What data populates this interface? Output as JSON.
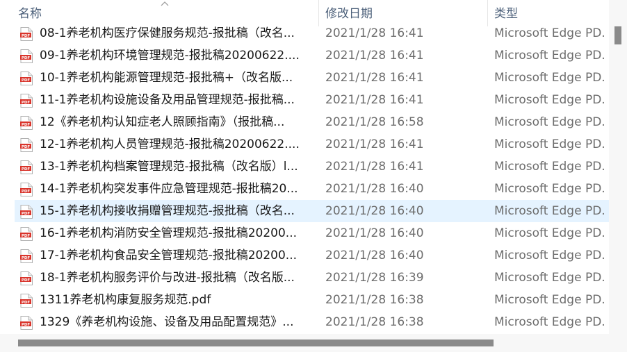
{
  "header": {
    "name_label": "名称",
    "date_label": "修改日期",
    "type_label": "类型"
  },
  "files": [
    {
      "name": "08-1养老机构医疗保健服务规范-报批稿（改名...",
      "date": "2021/1/28 16:41",
      "type": "Microsoft Edge PD."
    },
    {
      "name": "09-1养老机构环境管理规范-报批稿20200622....",
      "date": "2021/1/28 16:41",
      "type": "Microsoft Edge PD."
    },
    {
      "name": "10-1养老机构能源管理规范-报批稿+（改名版...",
      "date": "2021/1/28 16:41",
      "type": "Microsoft Edge PD."
    },
    {
      "name": "11-1养老机构设施设备及用品管理规范-报批稿...",
      "date": "2021/1/28 16:41",
      "type": "Microsoft Edge PD."
    },
    {
      "name": "12《养老机构认知症老人照顾指南》（报批稿...",
      "date": "2021/1/28 16:58",
      "type": "Microsoft Edge PD."
    },
    {
      "name": "12-1养老机构人员管理规范-报批稿20200622....",
      "date": "2021/1/28 16:41",
      "type": "Microsoft Edge PD."
    },
    {
      "name": "13-1养老机构档案管理规范-报批稿（改名版）l...",
      "date": "2021/1/28 16:41",
      "type": "Microsoft Edge PD."
    },
    {
      "name": "14-1养老机构突发事件应急管理规范-报批稿20...",
      "date": "2021/1/28 16:40",
      "type": "Microsoft Edge PD."
    },
    {
      "name": "15-1养老机构接收捐赠管理规范-报批稿（改名...",
      "date": "2021/1/28 16:40",
      "type": "Microsoft Edge PD."
    },
    {
      "name": "16-1养老机构消防安全管理规范-报批稿20200...",
      "date": "2021/1/28 16:40",
      "type": "Microsoft Edge PD."
    },
    {
      "name": "17-1养老机构食品安全管理规范-报批稿20200...",
      "date": "2021/1/28 16:40",
      "type": "Microsoft Edge PD."
    },
    {
      "name": "18-1养老机构服务评价与改进-报批稿（改名版...",
      "date": "2021/1/28 16:39",
      "type": "Microsoft Edge PD."
    },
    {
      "name": "1311养老机构康复服务规范.pdf",
      "date": "2021/1/28 16:38",
      "type": "Microsoft Edge PD."
    },
    {
      "name": "1329《养老机构设施、设备及用品配置规范》...",
      "date": "2021/1/28 16:38",
      "type": "Microsoft Edge PD."
    }
  ],
  "selected_index": 8,
  "icons": {
    "file": "pdf-file-icon",
    "sort": "sort-up-icon"
  },
  "colors": {
    "selection": "#e5f3ff",
    "pdf_red": "#d9342b",
    "header_text": "#4c607a"
  }
}
